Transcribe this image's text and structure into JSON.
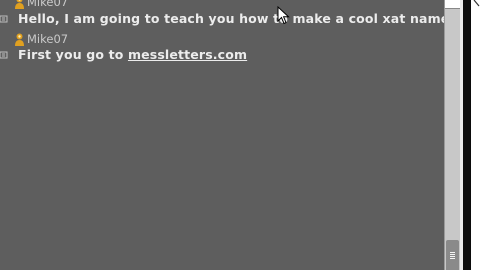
{
  "messages": [
    {
      "user": "Mike07",
      "text": "Hello, I am going to teach you how to make a cool xat name."
    },
    {
      "user": "Mike07",
      "text_prefix": "First you go to ",
      "link": "messletters.com"
    }
  ],
  "icons": {
    "user": "user-icon",
    "time": "time-icon",
    "cursor": "mouse-cursor-icon",
    "scroll_grip": "scroll-grip-icon"
  },
  "colors": {
    "chat_bg": "#5e5e5e",
    "text": "#ececec",
    "username": "#c9c9c9",
    "user_icon": "#e0a020"
  }
}
